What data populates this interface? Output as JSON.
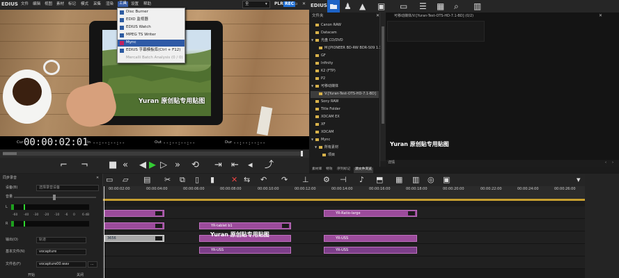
{
  "menubar": {
    "app": "EDIUS",
    "items": [
      "文件",
      "编辑",
      "视图",
      "素材",
      "标记",
      "模式",
      "采集",
      "渲染",
      "工具",
      "设置",
      "帮助"
    ],
    "active_index": 8,
    "mode_value": "全",
    "plr": "PLR",
    "rec": "REC"
  },
  "tools_menu": [
    {
      "label": "Disc Burner",
      "state": "normal"
    },
    {
      "label": "EDID 监视器",
      "state": "normal"
    },
    {
      "label": "EDIUS Watch",
      "state": "normal"
    },
    {
      "label": "MPEG TS Writer",
      "state": "normal"
    },
    {
      "label": "Mync",
      "state": "selected"
    },
    {
      "label": "EDIUS 字幕模板库(Ctrl + F12)",
      "state": "normal"
    },
    {
      "label": "Mercalli Batch Analysis (0 / 0)",
      "state": "disabled"
    }
  ],
  "preview": {
    "caption": "Yuran 原创贴专用贴图"
  },
  "timecode": {
    "cur_label": "Cur",
    "cur_value": "00:00:02:01",
    "in_label": "In",
    "in_value": "--:--:--:--",
    "out_label": "Out",
    "out_value": "--:--:--:--",
    "dur_label": "Dur",
    "dur_value": "--:--:--:--"
  },
  "library": {
    "app": "EDIUS",
    "tree_header": "文件夹",
    "tree": [
      {
        "label": "Canon RAW",
        "indent": 1,
        "arrow": ""
      },
      {
        "label": "Datacam",
        "indent": 1,
        "arrow": ""
      },
      {
        "label": "光盘 CD/DVD",
        "indent": 1,
        "arrow": "▼"
      },
      {
        "label": "M:[PIONEER BD-RW   BDR-S09 1.3",
        "indent": 2,
        "arrow": ""
      },
      {
        "label": "GF",
        "indent": 1,
        "arrow": ""
      },
      {
        "label": "Infinity",
        "indent": 1,
        "arrow": ""
      },
      {
        "label": "K2 (FTP)",
        "indent": 1,
        "arrow": ""
      },
      {
        "label": "P2",
        "indent": 1,
        "arrow": ""
      },
      {
        "label": "可移动媒体",
        "indent": 1,
        "arrow": "▼"
      },
      {
        "label": "V:[Yuran-Test-OTS-HD-7.1-BD]",
        "indent": 2,
        "arrow": "",
        "selected": true
      },
      {
        "label": "Sony RAW",
        "indent": 1,
        "arrow": ""
      },
      {
        "label": "Title Folder",
        "indent": 1,
        "arrow": ""
      },
      {
        "label": "XDCAM EX",
        "indent": 1,
        "arrow": ""
      },
      {
        "label": "XF",
        "indent": 1,
        "arrow": ""
      },
      {
        "label": "XDCAM",
        "indent": 1,
        "arrow": ""
      },
      {
        "label": "Mync",
        "indent": 1,
        "arrow": "▼"
      },
      {
        "label": "所有素材",
        "indent": 2,
        "arrow": "▼"
      },
      {
        "label": "项目",
        "indent": 3,
        "arrow": ""
      }
    ],
    "path": "可移动媒体/V:[Yuran-Test-OTS-HD-7.1-BD] (0/2)",
    "caption": "Yuran 原创贴专用贴图",
    "bottom_label": "详情",
    "tabs": [
      "素材库",
      "特效",
      "序列标记",
      "源文件浏览"
    ],
    "active_tab": 3
  },
  "audio_panel": {
    "title": "同步录音",
    "device_label": "设备(B)",
    "device_value": "选择录音设备",
    "volume_label": "音量",
    "scale": [
      "-60",
      "-40",
      "-30",
      "-20",
      "-10",
      "-6",
      "0",
      "6 dB"
    ],
    "output_label": "输出(O)",
    "output_value": "轨道",
    "name_label": "基本文件(N)",
    "name_value": "vocapture",
    "file_label": "文件名(F)",
    "file_value": "vocapture00.wav",
    "start_label": "开始",
    "close_label": "关闭"
  },
  "timeline": {
    "ticks": [
      "00:00:02:00",
      "00:00:04:00",
      "00:00:06:00",
      "00:00:08:00",
      "00:00:10:00",
      "00:00:12:00",
      "00:00:14:00",
      "00:00:16:00",
      "00:00:18:00",
      "00:00:20:00",
      "00:00:22:00",
      "00:00:24:00",
      "00:00:26:00"
    ],
    "clips": {
      "c1": "YR-Ratio-large",
      "c2": "YR-tablet b1",
      "c3": "3656",
      "c4": "YR-USS",
      "c5": "YR-USS",
      "c6": "YR-USS"
    },
    "caption": "Yuran 原创贴专用贴图"
  }
}
